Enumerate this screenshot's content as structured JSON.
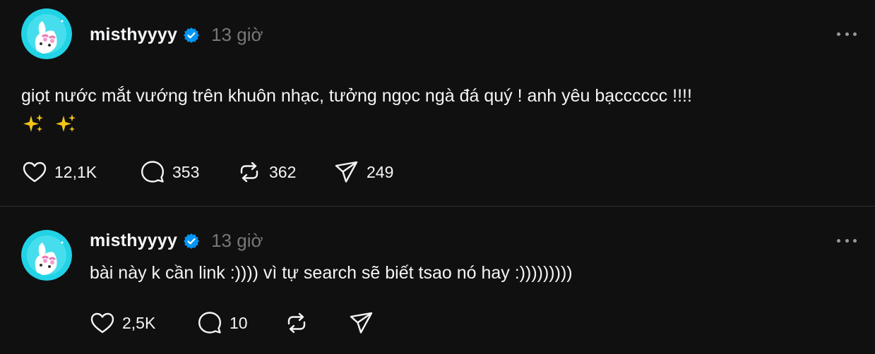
{
  "posts": [
    {
      "username": "misthyyyy",
      "time": "13 giờ",
      "text": "giọt nước mắt vướng trên khuôn nhạc, tưởng ngọc ngà đá quý ! anh yêu bạcccccc !!!!",
      "emoji_line": [
        "sparkles-icon",
        "sparkles-icon"
      ],
      "likes": "12,1K",
      "replies": "353",
      "reposts": "362",
      "shares": "249"
    },
    {
      "username": "misthyyyy",
      "time": "13 giờ",
      "text": "bài này k cần link :)))) vì tự search sẽ biết tsao nó hay :)))))))))",
      "likes": "2,5K",
      "replies": "10",
      "reposts": "",
      "shares": ""
    }
  ],
  "colors": {
    "background": "#101010",
    "text": "#f3f5f7",
    "muted": "#777777",
    "verified": "#0095f6",
    "divider": "#2d2d2d",
    "sparkle": "#f5c518"
  }
}
